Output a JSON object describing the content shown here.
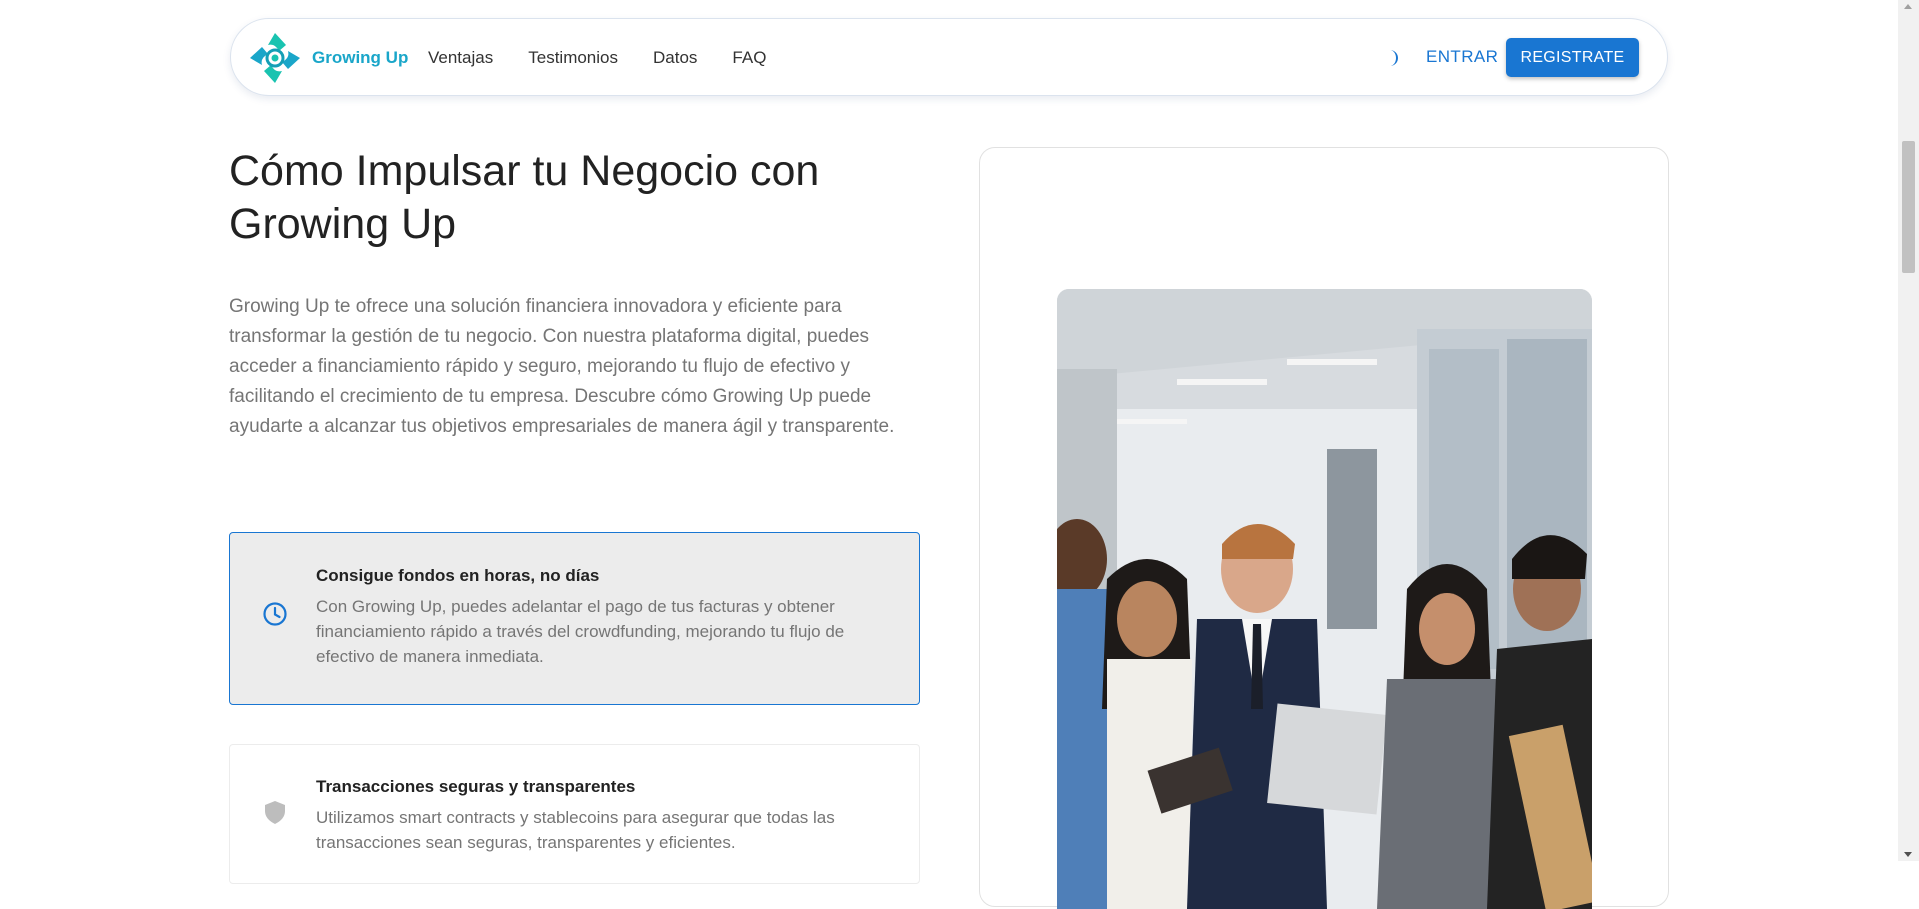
{
  "header": {
    "brand": "Growing Up",
    "nav": [
      "Ventajas",
      "Testimonios",
      "Datos",
      "FAQ"
    ],
    "theme_toggle_icon": "moon-icon",
    "login_label": "ENTRAR",
    "register_label": "REGISTRATE"
  },
  "hero": {
    "title": "Cómo Impulsar tu Negocio con Growing Up",
    "description": "Growing Up te ofrece una solución financiera innovadora y eficiente para transformar la gestión de tu negocio. Con nuestra plataforma digital, puedes acceder a financiamiento rápido y seguro, mejorando tu flujo de efectivo y facilitando el crecimiento de tu empresa. Descubre cómo Growing Up puede ayudarte a alcanzar tus objetivos empresariales de manera ágil y transparente."
  },
  "features": [
    {
      "icon": "clock-icon",
      "title": "Consigue fondos en horas, no días",
      "text": "Con Growing Up, puedes adelantar el pago de tus facturas y obtener financiamiento rápido a través del crowdfunding, mejorando tu flujo de efectivo de manera inmediata."
    },
    {
      "icon": "shield-icon",
      "title": "Transacciones seguras y transparentes",
      "text": "Utilizamos smart contracts y stablecoins para asegurar que todas las transacciones sean seguras, transparentes y eficientes."
    }
  ],
  "colors": {
    "primary": "#1976d2",
    "brand_teal": "#1aa6c9",
    "muted_text": "#757575",
    "active_card_bg": "#ececec"
  }
}
